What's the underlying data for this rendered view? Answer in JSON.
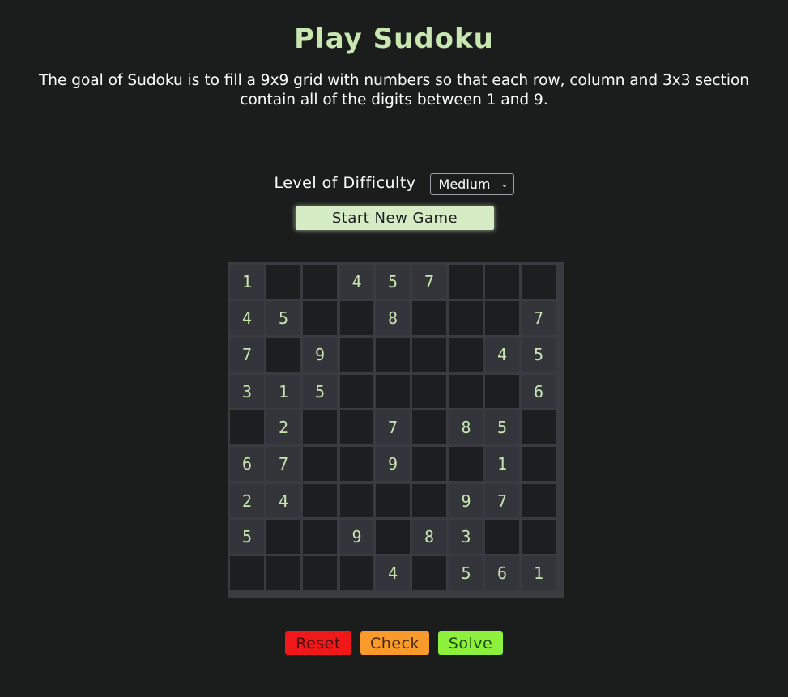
{
  "header": {
    "title": "Play Sudoku",
    "description": "The goal of Sudoku is to fill a 9x9 grid with numbers so that each row, column and 3x3 section contain all of the digits between 1 and 9."
  },
  "difficulty": {
    "label": "Level of Difficulty",
    "selected": "Medium"
  },
  "start_button": "Start New Game",
  "board": [
    [
      "1",
      "",
      "",
      "4",
      "5",
      "7",
      "",
      "",
      ""
    ],
    [
      "4",
      "5",
      "",
      "",
      "8",
      "",
      "",
      "",
      "7"
    ],
    [
      "7",
      "",
      "9",
      "",
      "",
      "",
      "",
      "4",
      "5"
    ],
    [
      "3",
      "1",
      "5",
      "",
      "",
      "",
      "",
      "",
      "6"
    ],
    [
      "",
      "2",
      "",
      "",
      "7",
      "",
      "8",
      "5",
      ""
    ],
    [
      "6",
      "7",
      "",
      "",
      "9",
      "",
      "",
      "1",
      ""
    ],
    [
      "2",
      "4",
      "",
      "",
      "",
      "",
      "9",
      "7",
      ""
    ],
    [
      "5",
      "",
      "",
      "9",
      "",
      "8",
      "3",
      "",
      ""
    ],
    [
      "",
      "",
      "",
      "",
      "4",
      "",
      "5",
      "6",
      "1"
    ]
  ],
  "actions": {
    "reset": "Reset",
    "check": "Check",
    "solve": "Solve"
  },
  "colors": {
    "background": "#1b1c1c",
    "accent": "#c8e6b0",
    "reset": "#f01818",
    "check": "#fa9a2a",
    "solve": "#8cf03c"
  }
}
